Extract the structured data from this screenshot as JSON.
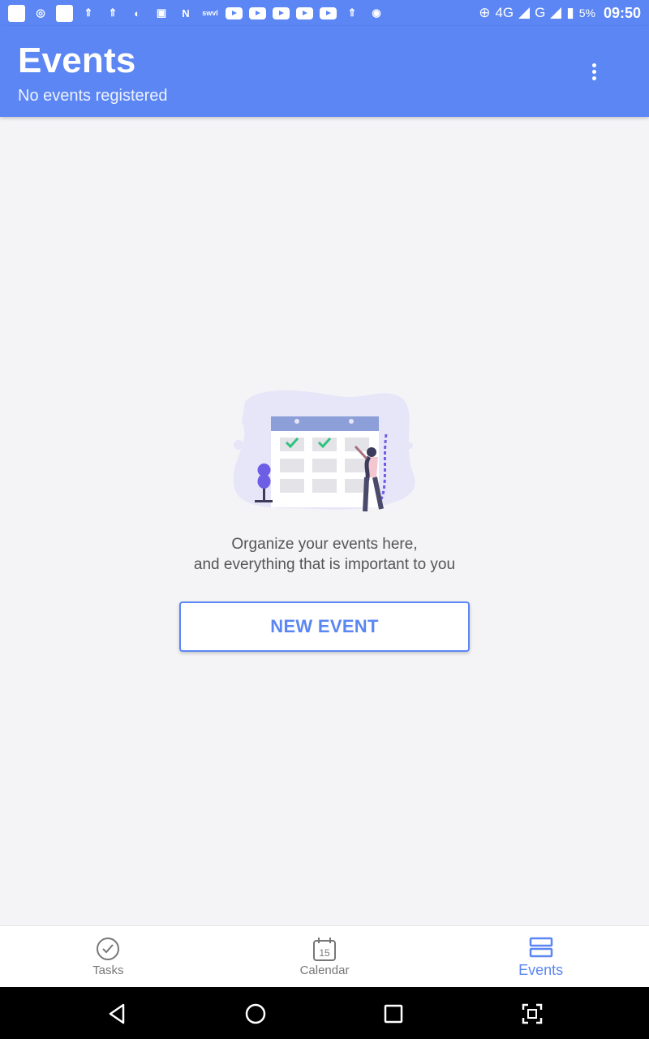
{
  "status_bar": {
    "network": "4G",
    "network2": "G",
    "battery": "5%",
    "time": "09:50",
    "notification_icons": [
      "app-icon",
      "chrome-icon",
      "ebay-icon",
      "usb-icon",
      "usb-icon",
      "sync-icon",
      "gallery-icon",
      "n-icon",
      "swvl-icon",
      "youtube-icon",
      "youtube-icon",
      "youtube-icon",
      "youtube-icon",
      "youtube-icon",
      "usb-icon",
      "free-icon"
    ]
  },
  "app_bar": {
    "title": "Events",
    "subtitle": "No events registered",
    "menu_icon": "more-vert-icon"
  },
  "empty_state": {
    "line1": "Organize your events here,",
    "line2": "and everything that is important to you",
    "button_label": "NEW EVENT"
  },
  "bottom_nav": {
    "items": [
      {
        "label": "Tasks",
        "icon": "check-circle-icon",
        "active": false
      },
      {
        "label": "Calendar",
        "icon": "calendar-icon",
        "icon_text": "15",
        "active": false
      },
      {
        "label": "Events",
        "icon": "events-list-icon",
        "active": true
      }
    ]
  },
  "colors": {
    "primary": "#5b86f3",
    "background": "#f4f4f7",
    "text_secondary": "#555555"
  }
}
